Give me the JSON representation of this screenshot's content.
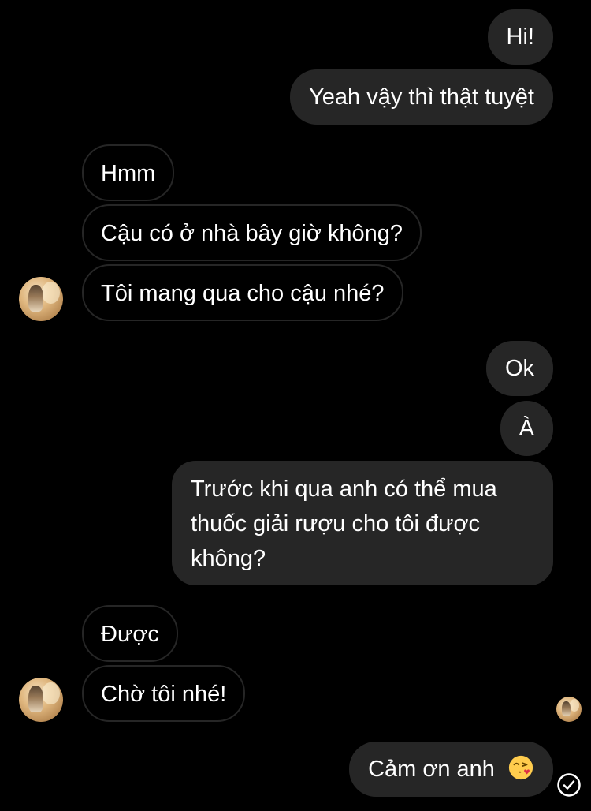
{
  "conversation": {
    "messages": [
      {
        "sender": "me",
        "text": "Hi!"
      },
      {
        "sender": "me",
        "text": "Yeah vậy thì thật tuyệt"
      },
      {
        "sender": "them",
        "text": "Hmm"
      },
      {
        "sender": "them",
        "text": "Cậu có ở nhà bây giờ không?"
      },
      {
        "sender": "them",
        "text": "Tôi mang qua cho cậu nhé?"
      },
      {
        "sender": "me",
        "text": "Ok"
      },
      {
        "sender": "me",
        "text": "À"
      },
      {
        "sender": "me",
        "text": "Trước khi qua anh có thể mua thuốc giải rượu cho tôi được không?"
      },
      {
        "sender": "them",
        "text": "Được"
      },
      {
        "sender": "them",
        "text": "Chờ tôi nhé!"
      },
      {
        "sender": "me",
        "text": "Cảm ơn anh",
        "emoji": "face-blowing-kiss"
      }
    ],
    "read_receipt": "seen-avatar",
    "status_icon": "check-circle-icon"
  },
  "colors": {
    "background": "#000000",
    "sent_bubble": "#262626",
    "received_border": "#262626",
    "text": "#ffffff"
  }
}
